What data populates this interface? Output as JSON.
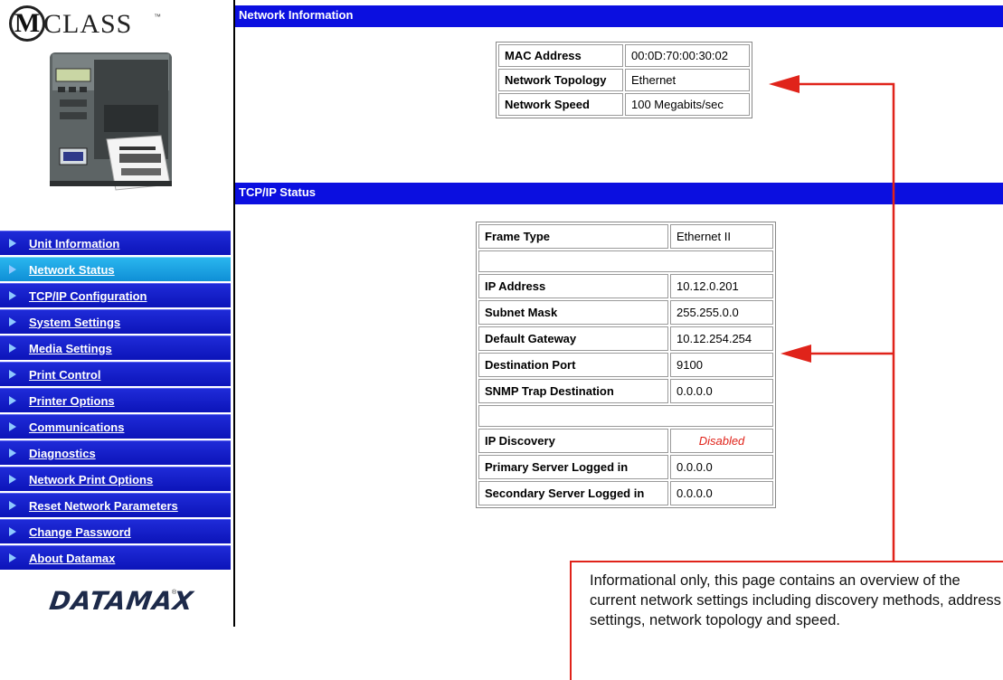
{
  "brand": {
    "logo_letter": "M",
    "logo_word": "CLASS",
    "logo_tm": "™",
    "footer_logo": "DATAMAX",
    "footer_tm": "®"
  },
  "nav": {
    "items": [
      {
        "label": "Unit Information",
        "active": false
      },
      {
        "label": "Network Status",
        "active": true
      },
      {
        "label": "TCP/IP Configuration",
        "active": false
      },
      {
        "label": "System Settings",
        "active": false
      },
      {
        "label": "Media Settings",
        "active": false
      },
      {
        "label": "Print Control",
        "active": false
      },
      {
        "label": "Printer Options",
        "active": false
      },
      {
        "label": "Communications",
        "active": false
      },
      {
        "label": "Diagnostics",
        "active": false
      },
      {
        "label": "Network Print Options",
        "active": false
      },
      {
        "label": "Reset Network Parameters",
        "active": false
      },
      {
        "label": "Change Password",
        "active": false
      },
      {
        "label": "About Datamax",
        "active": false
      }
    ]
  },
  "network_info": {
    "title": "Network Information",
    "rows": [
      {
        "key": "MAC Address",
        "value": "00:0D:70:00:30:02"
      },
      {
        "key": "Network Topology",
        "value": "Ethernet"
      },
      {
        "key": "Network Speed",
        "value": "100 Megabits/sec"
      }
    ]
  },
  "tcpip_status": {
    "title": "TCP/IP Status",
    "frame_type": {
      "key": "Frame Type",
      "value": "Ethernet II"
    },
    "ip_address": {
      "key": "IP Address",
      "value": "10.12.0.201"
    },
    "subnet_mask": {
      "key": "Subnet Mask",
      "value": "255.255.0.0"
    },
    "default_gateway": {
      "key": "Default Gateway",
      "value": "10.12.254.254"
    },
    "destination_port": {
      "key": "Destination Port",
      "value": "9100"
    },
    "snmp_trap": {
      "key": "SNMP Trap Destination",
      "value": "0.0.0.0"
    },
    "ip_discovery": {
      "key": "IP Discovery",
      "value": "Disabled"
    },
    "primary_server": {
      "key": "Primary Server Logged in",
      "value": "0.0.0.0"
    },
    "secondary_server": {
      "key": "Secondary Server Logged in",
      "value": "0.0.0.0"
    }
  },
  "callout": {
    "text": "Informational only, this page contains an overview of the current network settings including discovery methods, address settings, network topology and speed.",
    "color": "#e0231a"
  },
  "colors": {
    "nav_blue": "#0c14b9",
    "nav_active": "#1aa3e6",
    "header_blue": "#0b0fe0",
    "disabled_red": "#e0231a"
  }
}
